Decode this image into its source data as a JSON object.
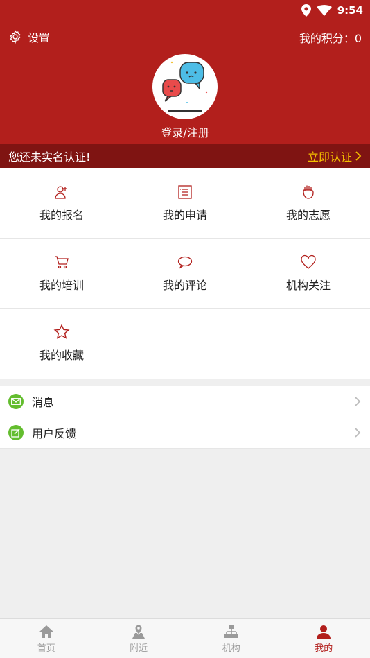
{
  "status": {
    "time": "9:54"
  },
  "header": {
    "settings_label": "设置",
    "points_label": "我的积分：0",
    "login_label": "登录/注册"
  },
  "verify": {
    "message": "您还未实名认证!",
    "action": "立即认证"
  },
  "grid": [
    {
      "label": "我的报名",
      "icon": "user-add-icon"
    },
    {
      "label": "我的申请",
      "icon": "list-icon"
    },
    {
      "label": "我的志愿",
      "icon": "hand-icon"
    },
    {
      "label": "我的培训",
      "icon": "cart-icon"
    },
    {
      "label": "我的评论",
      "icon": "comment-icon"
    },
    {
      "label": "机构关注",
      "icon": "heart-icon"
    },
    {
      "label": "我的收藏",
      "icon": "star-icon"
    }
  ],
  "list": [
    {
      "label": "消息",
      "icon": "mail-icon"
    },
    {
      "label": "用户反馈",
      "icon": "edit-icon"
    }
  ],
  "tabs": [
    {
      "label": "首页",
      "icon": "home-icon"
    },
    {
      "label": "附近",
      "icon": "map-pin-icon"
    },
    {
      "label": "机构",
      "icon": "org-chart-icon"
    },
    {
      "label": "我的",
      "icon": "person-icon"
    }
  ],
  "colors": {
    "brand": "#b21f1c",
    "brand_dark": "#7f1412",
    "accent": "#f5c000",
    "list_icon": "#63bd2e"
  }
}
